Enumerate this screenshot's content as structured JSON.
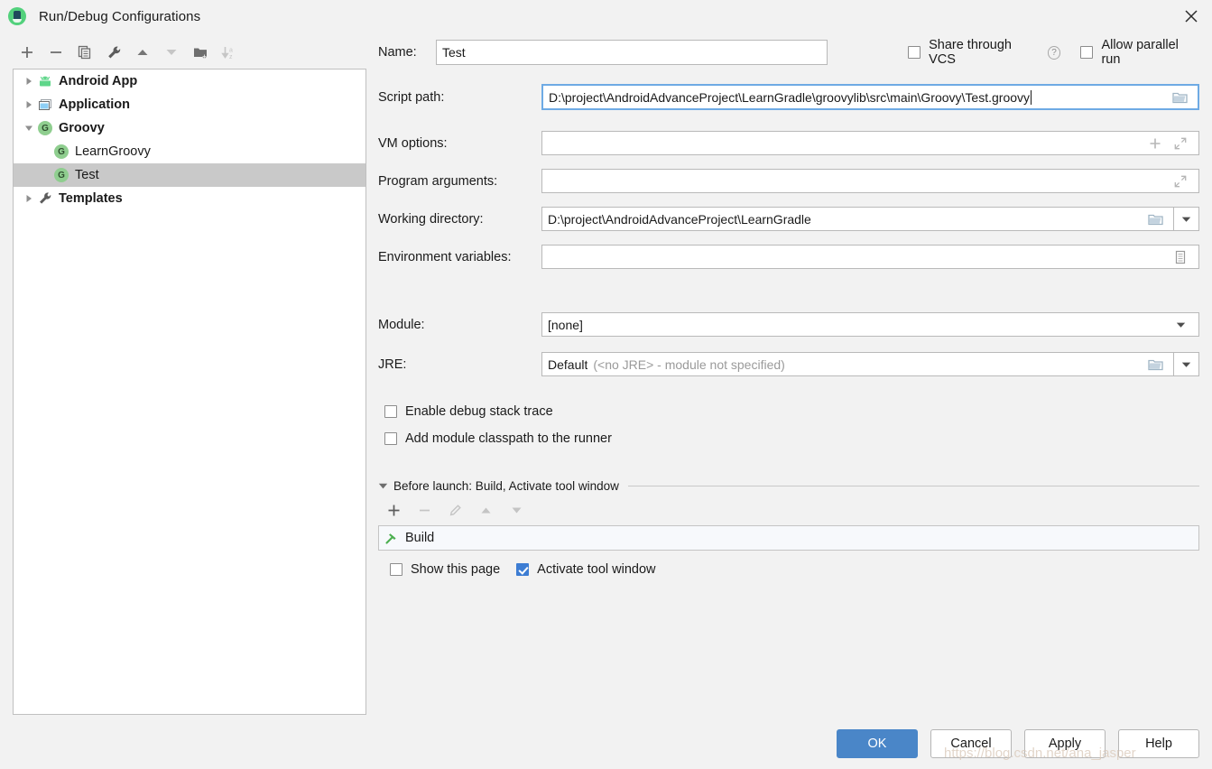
{
  "window": {
    "title": "Run/Debug Configurations",
    "app_icon": "android-studio-icon",
    "close_icon": "close-icon"
  },
  "toolbar": {
    "buttons": [
      {
        "name": "add-configuration-button",
        "icon": "plus-icon",
        "enabled": true
      },
      {
        "name": "remove-configuration-button",
        "icon": "minus-icon",
        "enabled": true
      },
      {
        "name": "copy-configuration-button",
        "icon": "copy-icon",
        "enabled": true
      },
      {
        "name": "edit-templates-button",
        "icon": "wrench-icon",
        "enabled": true
      },
      {
        "name": "move-up-button",
        "icon": "arrow-up-icon",
        "enabled": true
      },
      {
        "name": "move-down-button",
        "icon": "arrow-down-icon",
        "enabled": false
      },
      {
        "name": "new-folder-button",
        "icon": "folder-add-icon",
        "enabled": true
      },
      {
        "name": "sort-configurations-button",
        "icon": "sort-az-icon",
        "enabled": false
      }
    ]
  },
  "tree": {
    "items": [
      {
        "label": "Android App",
        "icon": "android-icon",
        "expandable": true,
        "expanded": false,
        "level": 0,
        "bold": true,
        "selected": false
      },
      {
        "label": "Application",
        "icon": "application-window-icon",
        "expandable": true,
        "expanded": false,
        "level": 0,
        "bold": true,
        "selected": false
      },
      {
        "label": "Groovy",
        "icon": "groovy-icon",
        "expandable": true,
        "expanded": true,
        "level": 0,
        "bold": true,
        "selected": false
      },
      {
        "label": "LearnGroovy",
        "icon": "groovy-icon",
        "expandable": false,
        "expanded": false,
        "level": 1,
        "bold": false,
        "selected": false
      },
      {
        "label": "Test",
        "icon": "groovy-icon",
        "expandable": false,
        "expanded": false,
        "level": 1,
        "bold": false,
        "selected": true
      },
      {
        "label": "Templates",
        "icon": "wrench-icon",
        "expandable": true,
        "expanded": false,
        "level": 0,
        "bold": true,
        "selected": false
      }
    ]
  },
  "form": {
    "name_label": "Name:",
    "name_value": "Test",
    "share_vcs_label": "Share through VCS",
    "share_vcs_checked": false,
    "share_vcs_help_icon": "help-icon",
    "allow_parallel_label": "Allow parallel run",
    "allow_parallel_checked": false,
    "script_path_label": "Script path:",
    "script_path_value": "D:\\project\\AndroidAdvanceProject\\LearnGradle\\groovylib\\src\\main\\Groovy\\Test.groovy",
    "script_path_focused": true,
    "vm_options_label": "VM options:",
    "vm_options_value": "",
    "program_arguments_label": "Program arguments:",
    "program_arguments_value": "",
    "working_directory_label": "Working directory:",
    "working_directory_value": "D:\\project\\AndroidAdvanceProject\\LearnGradle",
    "environment_variables_label": "Environment variables:",
    "environment_variables_value": "",
    "module_label": "Module:",
    "module_value": "[none]",
    "jre_label": "JRE:",
    "jre_value": "Default",
    "jre_hint": "(<no JRE> - module not specified)",
    "enable_debug_label": "Enable debug stack trace",
    "enable_debug_checked": false,
    "add_classpath_label": "Add module classpath to the runner",
    "add_classpath_checked": false
  },
  "before_launch": {
    "title": "Before launch: Build, Activate tool window",
    "expanded": true,
    "toolbar": [
      {
        "name": "before-launch-add-button",
        "icon": "plus-icon",
        "enabled": true
      },
      {
        "name": "before-launch-remove-button",
        "icon": "minus-icon",
        "enabled": false
      },
      {
        "name": "before-launch-edit-button",
        "icon": "pencil-icon",
        "enabled": false
      },
      {
        "name": "before-launch-move-up-button",
        "icon": "arrow-up-icon",
        "enabled": false
      },
      {
        "name": "before-launch-move-down-button",
        "icon": "arrow-down-icon",
        "enabled": false
      }
    ],
    "tasks": [
      {
        "label": "Build",
        "icon": "hammer-icon"
      }
    ],
    "show_page_label": "Show this page",
    "show_page_checked": false,
    "activate_tool_window_label": "Activate tool window",
    "activate_tool_window_checked": true
  },
  "footer": {
    "ok_label": "OK",
    "cancel_label": "Cancel",
    "apply_label": "Apply",
    "help_label": "Help"
  },
  "watermark": "https://blog.csdn.net/ana_jasper",
  "colors": {
    "accent": "#4a86c8",
    "focus_border": "#6eaae4",
    "selection": "#c9c9c9",
    "background": "#f2f2f2",
    "groovy_green": "#8fce8f",
    "android_green": "#52d17c"
  }
}
